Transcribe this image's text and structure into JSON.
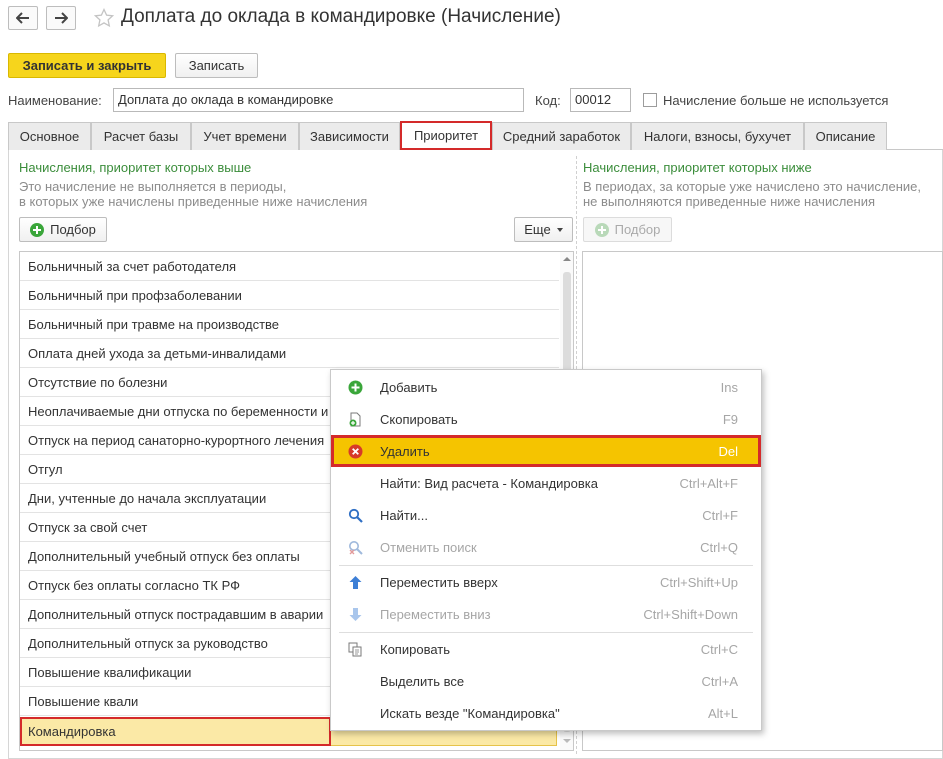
{
  "header": {
    "back_icon": "arrow-left-icon",
    "forward_icon": "arrow-right-icon",
    "favorite_icon": "star-icon",
    "title": "Доплата до оклада в командировке (Начисление)"
  },
  "toolbar": {
    "save_close_label": "Записать и закрыть",
    "save_label": "Записать"
  },
  "form": {
    "name_label": "Наименование:",
    "name_value": "Доплата до оклада в командировке",
    "code_label": "Код:",
    "code_value": "00012",
    "not_used_label": "Начисление больше не используется",
    "not_used_checked": false
  },
  "tabs": [
    {
      "label": "Основное"
    },
    {
      "label": "Расчет базы"
    },
    {
      "label": "Учет времени"
    },
    {
      "label": "Зависимости"
    },
    {
      "label": "Приоритет",
      "active": true
    },
    {
      "label": "Средний заработок"
    },
    {
      "label": "Налоги, взносы, бухучет"
    },
    {
      "label": "Описание"
    }
  ],
  "left_panel": {
    "title": "Начисления, приоритет которых выше",
    "note_line1": "Это начисление не выполняется в периоды,",
    "note_line2": "в которых уже начислены приведенные ниже начисления",
    "pick_label": "Подбор",
    "more_label": "Еще",
    "items": [
      "Больничный за счет работодателя",
      "Больничный при профзаболевании",
      "Больничный при травме на производстве",
      "Оплата дней ухода за детьми-инвалидами",
      "Отсутствие по болезни",
      "Неоплачиваемые дни отпуска по беременности и",
      "Отпуск на период санаторно-курортного лечения",
      "Отгул",
      "Дни, учтенные до начала эксплуатации",
      "Отпуск за свой счет",
      "Дополнительный учебный отпуск без оплаты",
      "Отпуск без оплаты согласно ТК РФ",
      "Дополнительный отпуск пострадавшим в аварии",
      "Дополнительный отпуск за руководство",
      "Повышение квалификации",
      "Повышение квали",
      "Командировка"
    ],
    "selected_index": 16
  },
  "right_panel": {
    "title": "Начисления, приоритет которых ниже",
    "note_line1": "В периодах, за которые уже начислено это начисление,",
    "note_line2": "не выполняются приведенные ниже начисления",
    "pick_label": "Подбор"
  },
  "context_menu": {
    "items": [
      {
        "label": "Добавить",
        "shortcut": "Ins",
        "icon": "add-icon"
      },
      {
        "label": "Скопировать",
        "shortcut": "F9",
        "icon": "copy-icon"
      },
      {
        "label": "Удалить",
        "shortcut": "Del",
        "icon": "delete-icon",
        "highlighted": true
      },
      {
        "label": "Найти: Вид расчета - Командировка",
        "shortcut": "Ctrl+Alt+F",
        "icon": ""
      },
      {
        "label": "Найти...",
        "shortcut": "Ctrl+F",
        "icon": "search-icon"
      },
      {
        "label": "Отменить поиск",
        "shortcut": "Ctrl+Q",
        "icon": "cancel-search-icon",
        "disabled": true
      },
      {
        "label": "Переместить вверх",
        "shortcut": "Ctrl+Shift+Up",
        "icon": "arrow-up-icon"
      },
      {
        "label": "Переместить вниз",
        "shortcut": "Ctrl+Shift+Down",
        "icon": "arrow-down-icon",
        "disabled": true
      },
      {
        "label": "Копировать",
        "shortcut": "Ctrl+C",
        "icon": "clipboard-copy-icon"
      },
      {
        "label": "Выделить все",
        "shortcut": "Ctrl+A",
        "icon": ""
      },
      {
        "label": "Искать везде \"Командировка\"",
        "shortcut": "Alt+L",
        "icon": ""
      }
    ]
  },
  "colors": {
    "accent_yellow": "#f6d51c",
    "highlight_red": "#d42a2a",
    "green_title": "#3b8d3b"
  }
}
